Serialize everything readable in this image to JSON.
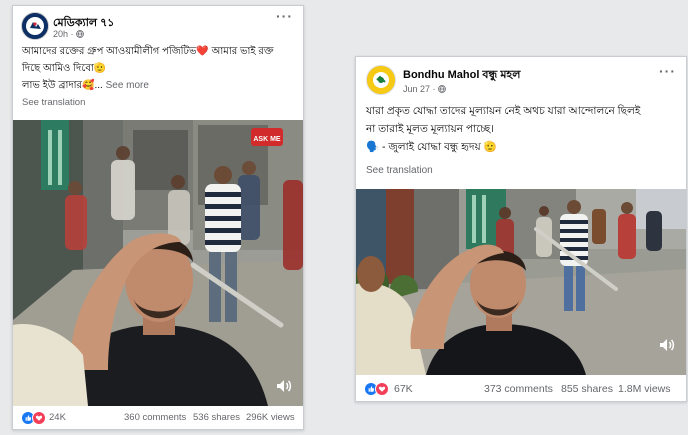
{
  "post1": {
    "page_name": "মেডিক্যাল ৭১",
    "time": "20h",
    "text_line1": "আমাদের রক্তের গ্রুপ আওয়ামীলীগ পজিটিভ❤️ আমার ভাই রক্ত",
    "text_line2": "দিছে আমিও দিবো🫡",
    "text_line3": "লাভ ইউ ব্রাদার🥰...",
    "see_more": "See more",
    "see_translation": "See translation",
    "video_sticker": "ASK ME",
    "reactions_count": "24K",
    "comments": "360 comments",
    "shares": "536 shares",
    "views": "296K views"
  },
  "post2": {
    "page_name": "Bondhu Mahol বন্ধু মহল",
    "time": "Jun 27",
    "text_line1": "যারা প্রকৃত যোদ্ধা তাদের মূল্যায়ন নেই অথচ যারা আন্দোলনে ছিলই",
    "text_line2": "না তারাই মূলত মূল্যায়ন পাচ্ছে।",
    "text_line3": "🗣️ - জুলাই যোদ্ধা বন্ধু হৃদয় 🫡",
    "see_translation": "See translation",
    "reactions_count": "67K",
    "comments": "373 comments",
    "shares": "855 shares",
    "views": "1.8M views"
  },
  "icons": {
    "globe": "globe-icon",
    "more": "more-options-icon",
    "sound": "sound-icon",
    "like": "like-icon",
    "love": "love-icon",
    "care": "care-icon"
  },
  "colors": {
    "like": "#1877f2",
    "love": "#f33e58",
    "care": "#f7b125",
    "meta_text": "#65676b"
  }
}
